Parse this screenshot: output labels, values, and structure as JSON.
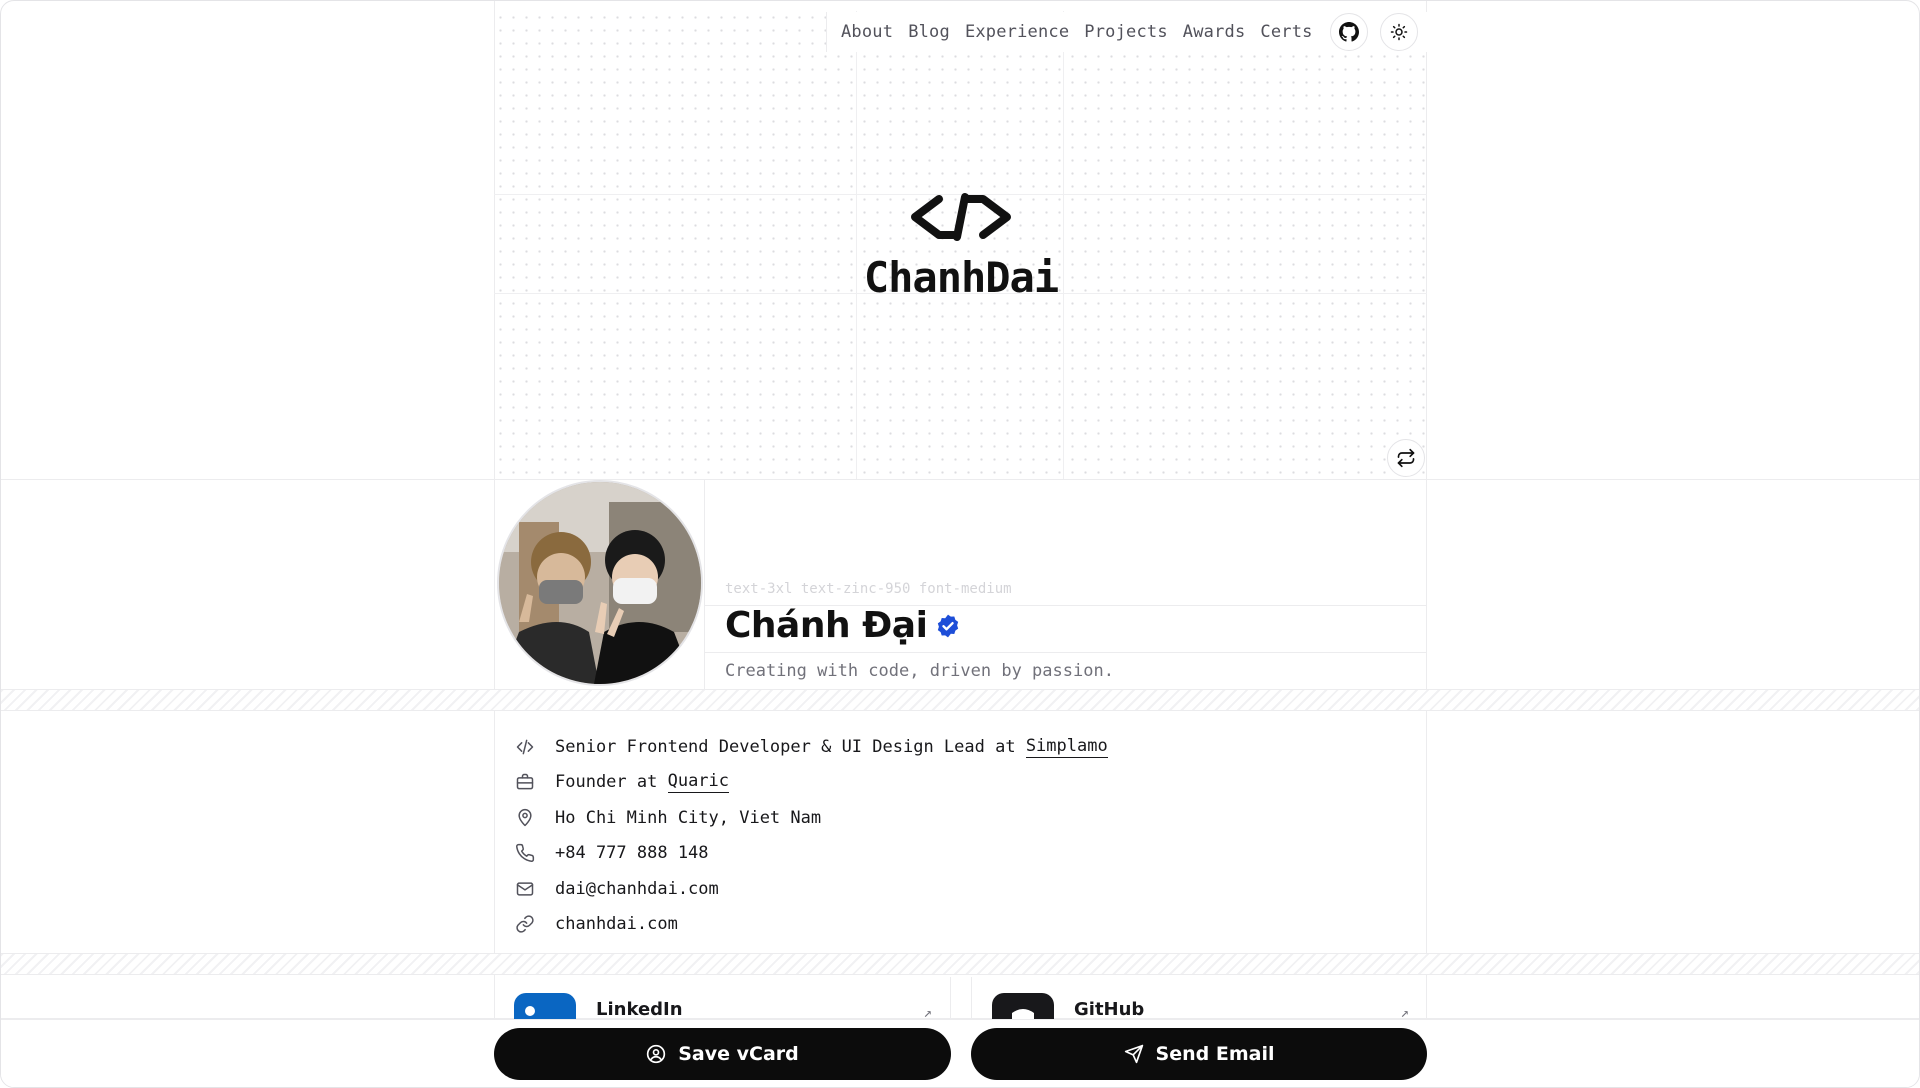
{
  "nav": {
    "links": [
      "About",
      "Blog",
      "Experience",
      "Projects",
      "Awards",
      "Certs"
    ],
    "github_icon": "github-icon",
    "theme_icon": "sun-icon"
  },
  "hero": {
    "logo_text": "ChanhDai",
    "logo_icon": "code-brackets-logo",
    "swap_icon": "repeat-icon"
  },
  "profile": {
    "class_hint": "text-3xl text-zinc-950 font-medium",
    "name": "Chánh Đại",
    "verified_icon": "verified-badge-icon",
    "tagline": "Creating with code, driven by passion."
  },
  "info": {
    "job_prefix": "Senior Frontend Developer & UI Design Lead at ",
    "job_company": "Simplamo",
    "founder_prefix": "Founder at ",
    "founder_company": "Quaric",
    "location": "Ho Chi Minh City, Viet Nam",
    "phone": "+84 777 888 148",
    "email": "dai@chanhdai.com",
    "website": "chanhdai.com"
  },
  "social": {
    "linkedin": "LinkedIn",
    "github": "GitHub"
  },
  "actions": {
    "save_vcard": "Save vCard",
    "send_email": "Send Email"
  },
  "colors": {
    "accent_blue": "#1d4ed8",
    "linkedin_blue": "#0a66c2",
    "button_bg": "#0c0c0c"
  }
}
